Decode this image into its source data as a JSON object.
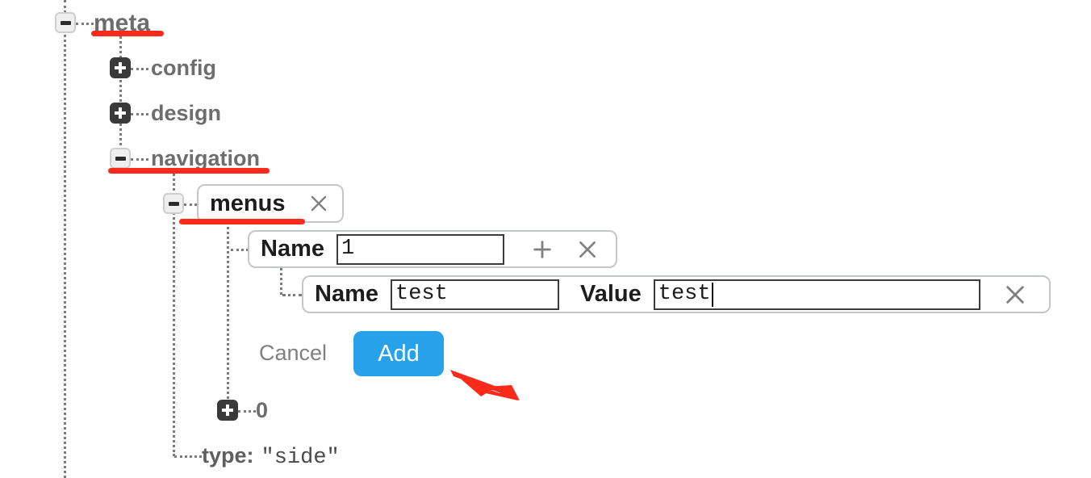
{
  "tree": {
    "nodes": [
      {
        "id": "meta",
        "label": "meta",
        "toggle": "minus",
        "highlighted": true
      },
      {
        "id": "config",
        "label": "config",
        "toggle": "plus",
        "highlighted": false
      },
      {
        "id": "design",
        "label": "design",
        "toggle": "plus",
        "highlighted": false
      },
      {
        "id": "navigation",
        "label": "navigation",
        "toggle": "minus",
        "highlighted": true
      },
      {
        "id": "menus",
        "label": "menus",
        "toggle": "minus",
        "highlighted": true
      },
      {
        "id": "zero",
        "label": "0",
        "toggle": "plus",
        "highlighted": false
      }
    ],
    "leaf": {
      "key": "type:",
      "value": "\"side\""
    }
  },
  "menus_card": {
    "title": "menus",
    "remove_icon": "close-icon"
  },
  "name_row": {
    "label": "Name",
    "input_value": "1",
    "input_placeholder": "",
    "add_icon": "plus-icon",
    "remove_icon": "close-icon"
  },
  "pair_row": {
    "name_label": "Name",
    "name_value": "test",
    "name_placeholder": "",
    "value_label": "Value",
    "value_value": "test",
    "value_placeholder": "",
    "remove_icon": "close-icon"
  },
  "actions": {
    "cancel_label": "Cancel",
    "add_label": "Add"
  },
  "icons": {
    "expand": "plus-square-icon",
    "collapse": "minus-square-icon"
  },
  "colors": {
    "annotation_red": "#fb2a1b",
    "add_button_blue": "#28a0ea",
    "node_text_gray": "#6d6d6d",
    "input_border": "#3c3c3c",
    "card_border": "#c3c7cc"
  }
}
